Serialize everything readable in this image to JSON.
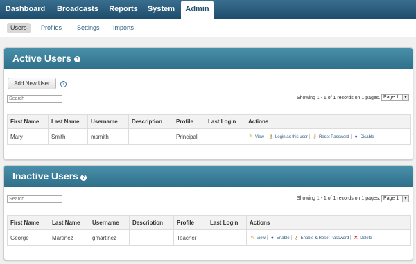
{
  "topnav": {
    "tabs": [
      {
        "label": "Dashboard"
      },
      {
        "label": "Broadcasts"
      },
      {
        "label": "Reports"
      },
      {
        "label": "System"
      },
      {
        "label": "Admin"
      }
    ]
  },
  "subnav": {
    "items": [
      {
        "label": "Users"
      },
      {
        "label": "Profiles"
      },
      {
        "label": "Settings"
      },
      {
        "label": "Imports"
      }
    ]
  },
  "active_users": {
    "title": "Active Users",
    "add_button": "Add New User",
    "search_placeholder": "Search",
    "pager_text": "Showing 1 - 1 of 1 records on 1 pages.",
    "page_select": "Page 1",
    "columns": [
      "First Name",
      "Last Name",
      "Username",
      "Description",
      "Profile",
      "Last Login",
      "Actions"
    ],
    "rows": [
      {
        "first": "Mary",
        "last": "Smith",
        "username": "msmith",
        "description": "",
        "profile": "Principal",
        "last_login": ""
      }
    ],
    "actions": [
      "View",
      "Login as this user",
      "Reset Password",
      "Disable"
    ]
  },
  "inactive_users": {
    "title": "Inactive Users",
    "search_placeholder": "Search",
    "pager_text": "Showing 1 - 1 of 1 records on 1 pages.",
    "page_select": "Page 1",
    "columns": [
      "First Name",
      "Last Name",
      "Username",
      "Description",
      "Profile",
      "Last Login",
      "Actions"
    ],
    "rows": [
      {
        "first": "George",
        "last": "Martinez",
        "username": "gmartinez",
        "description": "",
        "profile": "Teacher",
        "last_login": ""
      }
    ],
    "actions": [
      "View",
      "Enable",
      "Enable & Reset Password",
      "Delete"
    ]
  }
}
